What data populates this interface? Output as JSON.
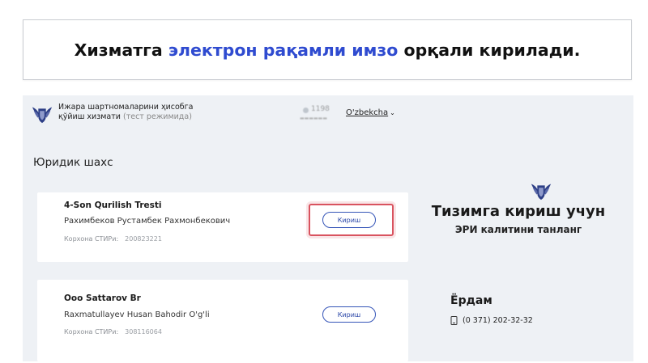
{
  "banner": {
    "text_before": "Хизматга",
    "text_highlight": "электрон рақамли имзо",
    "text_after": "орқали кирилади.",
    "highlight_color": "#2f4bd0"
  },
  "header": {
    "title_line1": "Ижара шартномаларини ҳисобга",
    "title_line2": "қўйиш хизмати",
    "mode": "(тест режимида)",
    "user_count": "1198",
    "language": "O'zbekcha"
  },
  "section_title": "Юридик шахс",
  "organizations": [
    {
      "name": "4-Son Qurilish Tresti",
      "person": "Рахимбеков Рустамбек Рахмонбекович",
      "tin_label": "Корхона СТИРи:",
      "tin_value": "200823221",
      "login_label": "Кириш"
    },
    {
      "name": "Ooo Sattarov Br",
      "person": "Raxmatullayev Husan Bahodir O'g'li",
      "tin_label": "Корхона СТИРи:",
      "tin_value": "308116064",
      "login_label": "Кириш"
    }
  ],
  "sidebar": {
    "title": "Тизимга кириш учун",
    "subtitle": "ЭРИ калитини танланг",
    "help_title": "Ёрдам",
    "help_phone": "(0 371) 202-32-32"
  },
  "colors": {
    "accent": "#2b47a8",
    "highlight_border": "#d9535f",
    "panel_bg": "#eef1f5"
  },
  "icons": [
    "logo-icon",
    "chevron-down-icon",
    "phone-icon"
  ]
}
